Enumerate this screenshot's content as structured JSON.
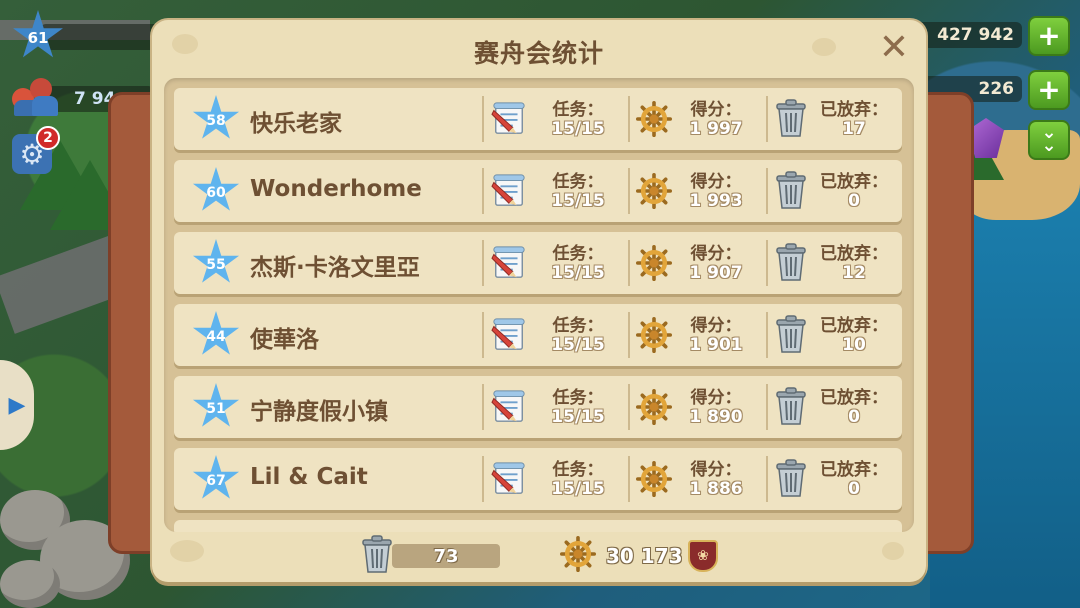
{
  "hud": {
    "level": "61",
    "coins": "427 942",
    "population": "7 94",
    "gems": "226",
    "notifications": "2"
  },
  "dialog": {
    "title": "赛舟会统计",
    "labels": {
      "tasks": "任务：",
      "score": "得分：",
      "abandoned": "已放弃："
    }
  },
  "rows": [
    {
      "level": "58",
      "name": "快乐老家",
      "tasks": "15/15",
      "score": "1 997",
      "abandoned": "17"
    },
    {
      "level": "60",
      "name": "Wonderhome",
      "tasks": "15/15",
      "score": "1 993",
      "abandoned": "0"
    },
    {
      "level": "55",
      "name": "杰斯·卡洛文里亞",
      "tasks": "15/15",
      "score": "1 907",
      "abandoned": "12"
    },
    {
      "level": "44",
      "name": "使華洛",
      "tasks": "15/15",
      "score": "1 901",
      "abandoned": "10"
    },
    {
      "level": "51",
      "name": "宁静度假小镇",
      "tasks": "15/15",
      "score": "1 890",
      "abandoned": "0"
    },
    {
      "level": "67",
      "name": "Lil & Cait",
      "tasks": "15/15",
      "score": "1 886",
      "abandoned": "0"
    }
  ],
  "footer": {
    "total_abandoned": "73",
    "total_score": "30 173"
  },
  "icons": {
    "tasks": "task-scroll-icon",
    "score": "ship-wheel-icon",
    "abandoned": "trash-can-icon",
    "close": "close-icon",
    "crest": "club-crest-icon"
  },
  "colors": {
    "panel": "#ecdfb9",
    "row": "#efe3c2",
    "text_brown": "#6e5033",
    "rank_star": "#5fb4ee",
    "plus_green": "#5fae2a"
  }
}
